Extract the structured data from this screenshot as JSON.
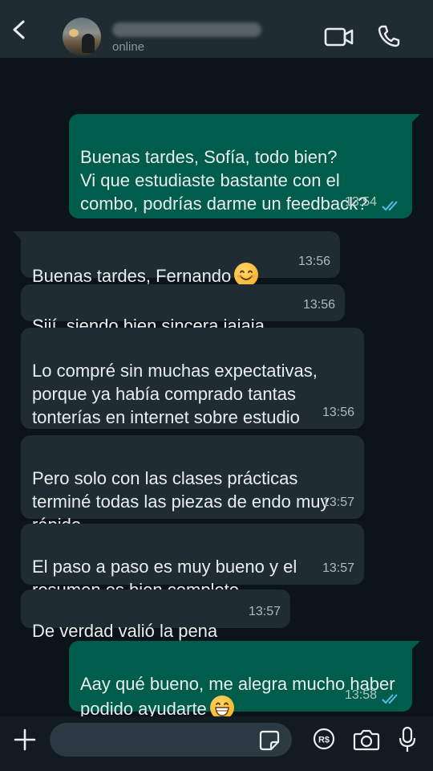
{
  "header": {
    "status": "online",
    "icons": {
      "back": "back-arrow-icon",
      "video": "video-call-icon",
      "call": "phone-icon"
    }
  },
  "messages": [
    {
      "id": "m1",
      "direction": "outgoing",
      "text": "Buenas tardes, Sofía, todo bien?\nVi que estudiaste bastante con el combo, podrías darme un feedback?",
      "time": "13:54",
      "read": true
    },
    {
      "id": "m2",
      "direction": "incoming",
      "text": "Buenas tardes, Fernando",
      "emoji": "smiling-face-emoji",
      "time": "13:56"
    },
    {
      "id": "m3",
      "direction": "incoming",
      "text": "Siií, siendo bien sincera jajaja",
      "time": "13:56"
    },
    {
      "id": "m4",
      "direction": "incoming",
      "text": "Lo compré sin muchas expectativas, porque ya había comprado tantas tonterías en internet sobre estudio",
      "time": "13:56"
    },
    {
      "id": "m5",
      "direction": "incoming",
      "text": "Pero solo con las clases prácticas terminé todas las piezas de endo muy rápido",
      "time": "13:57"
    },
    {
      "id": "m6",
      "direction": "incoming",
      "text": "El paso a paso es muy bueno y el resumen es bien completo",
      "time": "13:57"
    },
    {
      "id": "m7",
      "direction": "incoming",
      "text": "De verdad valió la pena",
      "time": "13:57"
    },
    {
      "id": "m8",
      "direction": "outgoing",
      "text": "Aay qué bueno, me alegra mucho haber podido ayudarte",
      "emoji": "grinning-face-emoji",
      "time": "13:58",
      "read": true
    }
  ],
  "composer": {
    "icons": [
      "plus-icon",
      "sticker-icon",
      "payment-icon",
      "camera-icon",
      "microphone-icon"
    ]
  },
  "colors": {
    "background": "#0b141a",
    "header": "#1f2c34",
    "outgoing_bubble": "#005c4b",
    "incoming_bubble": "#1f2c34",
    "read_ticks": "#53bdeb"
  }
}
